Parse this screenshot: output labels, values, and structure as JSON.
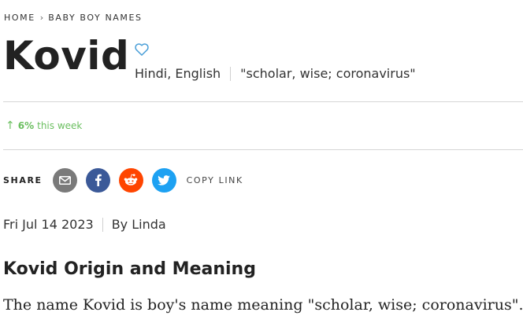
{
  "breadcrumb": {
    "items": [
      "HOME",
      "BABY BOY NAMES"
    ],
    "separator": "›"
  },
  "name": {
    "title": "Kovid",
    "origin": "Hindi, English",
    "meaning": "\"scholar, wise; coronavirus\"",
    "favorite_icon": "heart-outline-icon"
  },
  "trend": {
    "direction_icon": "arrow-up-icon",
    "percent": "6%",
    "period": "this week",
    "color": "#6bbf60"
  },
  "share": {
    "label": "SHARE",
    "buttons": [
      {
        "name": "email",
        "icon": "email-icon",
        "color": "#7a7a7a"
      },
      {
        "name": "facebook",
        "icon": "facebook-icon",
        "color": "#3b5998"
      },
      {
        "name": "reddit",
        "icon": "reddit-icon",
        "color": "#ff4500"
      },
      {
        "name": "twitter",
        "icon": "twitter-icon",
        "color": "#1da1f2"
      }
    ],
    "copy_link": "COPY LINK"
  },
  "article": {
    "date": "Fri Jul 14 2023",
    "author": "By Linda",
    "heading": "Kovid Origin and Meaning",
    "body": "The name Kovid is boy's name meaning \"scholar, wise; coronavirus\"."
  }
}
